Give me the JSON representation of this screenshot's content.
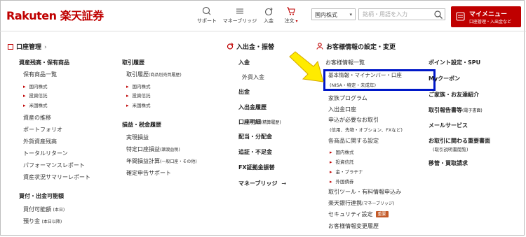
{
  "header": {
    "logo": "Rakuten 楽天証券",
    "nav": [
      {
        "label": "サポート",
        "icon": "chat-icon"
      },
      {
        "label": "マネーブリッジ",
        "icon": "money-bridge-icon"
      },
      {
        "label": "入金",
        "icon": "deposit-icon"
      },
      {
        "label": "注文",
        "icon": "cart-icon"
      }
    ],
    "market_select": "国内株式",
    "search_placeholder": "銘柄・用語を入力",
    "mymenu": {
      "title": "マイメニュー",
      "subtitle": "口座管理・入出金など"
    }
  },
  "col1": {
    "title": "口座管理",
    "groups": [
      {
        "heading": "資産残高・保有商品"
      },
      {
        "heading": "買付・出金可能額"
      }
    ],
    "items": {
      "hold": "保有商品一覧",
      "hold_subs": [
        "国内株式",
        "投資信託",
        "米国株式"
      ],
      "links": [
        "資産の推移",
        "ポートフォリオ",
        "外貨資産残高",
        "トータルリターン",
        "パフォーマンスレポート",
        "資産状況サマリーレポート"
      ],
      "kaitsuke": "買付可能額",
      "kaitsuke_note": "(本日)",
      "azukari": "預り金",
      "azukari_note": "(本日以降)"
    }
  },
  "col2": {
    "heading1": "取引履歴",
    "history": "取引履歴",
    "history_note": "(商品別売買履歴)",
    "history_subs": [
      "国内株式",
      "投資信託",
      "米国株式"
    ],
    "heading2": "損益・税金履歴",
    "links": [
      "実現損益"
    ],
    "tokutei": "特定口座損益",
    "tokutei_note": "(譲渡益税)",
    "nenkan": "年間損益計算",
    "nenkan_note": "(一般口座・その他)",
    "kakutei": "確定申告サポート"
  },
  "col3": {
    "title": "入出金・振替",
    "nyukin": "入金",
    "gaika": "外貨入金",
    "shukkin": "出金",
    "rireki": "入出金履歴",
    "meisai": "口座明細",
    "meisai_note": "(精算履歴)",
    "haito": "配当・分配金",
    "tsuisho": "追証・不足金",
    "fx": "FX証拠金振替",
    "bridge": "マネーブリッジ",
    "bridge_arrow": "→"
  },
  "col4": {
    "title": "お客様情報の設定・変更",
    "list_heading": "お客様情報一覧",
    "kihon": "基本情報・マイナンバー・口座",
    "kihon_note": "(NISA・特定・未成年)",
    "family": "家族プログラム",
    "nyukin_koza": "入出金口座",
    "moshikomi": "申込が必要なお取引",
    "moshikomi_note": "(信用、先物・オプション、FXなど)",
    "shohin": "各商品に関する設定",
    "shohin_subs": [
      "国内株式",
      "投資信託",
      "金・プラチナ",
      "外国債券"
    ],
    "tool": "取引ツール・有料情報申込み",
    "bank": "楽天銀行連携",
    "bank_note": "(マネーブリッジ)",
    "security": "セキュリティ設定",
    "security_badge": "重要",
    "henko": "お客様情報変更履歴"
  },
  "col5": {
    "items": [
      {
        "label": "ポイント設定・SPU",
        "note": ""
      },
      {
        "label": "Myクーポン",
        "note": ""
      },
      {
        "label": "ご家族・お友達紹介",
        "note": ""
      },
      {
        "label": "取引報告書等",
        "note": "(電子書面)"
      },
      {
        "label": "メールサービス",
        "note": ""
      },
      {
        "label": "お取引に関わる重要書面",
        "note": "(取引説明書閲覧)"
      },
      {
        "label": "移管・買取請求",
        "note": ""
      }
    ]
  },
  "colors": {
    "brand": "#bf0000",
    "highlight": "#0018c8",
    "arrow": "#ffeb00"
  }
}
